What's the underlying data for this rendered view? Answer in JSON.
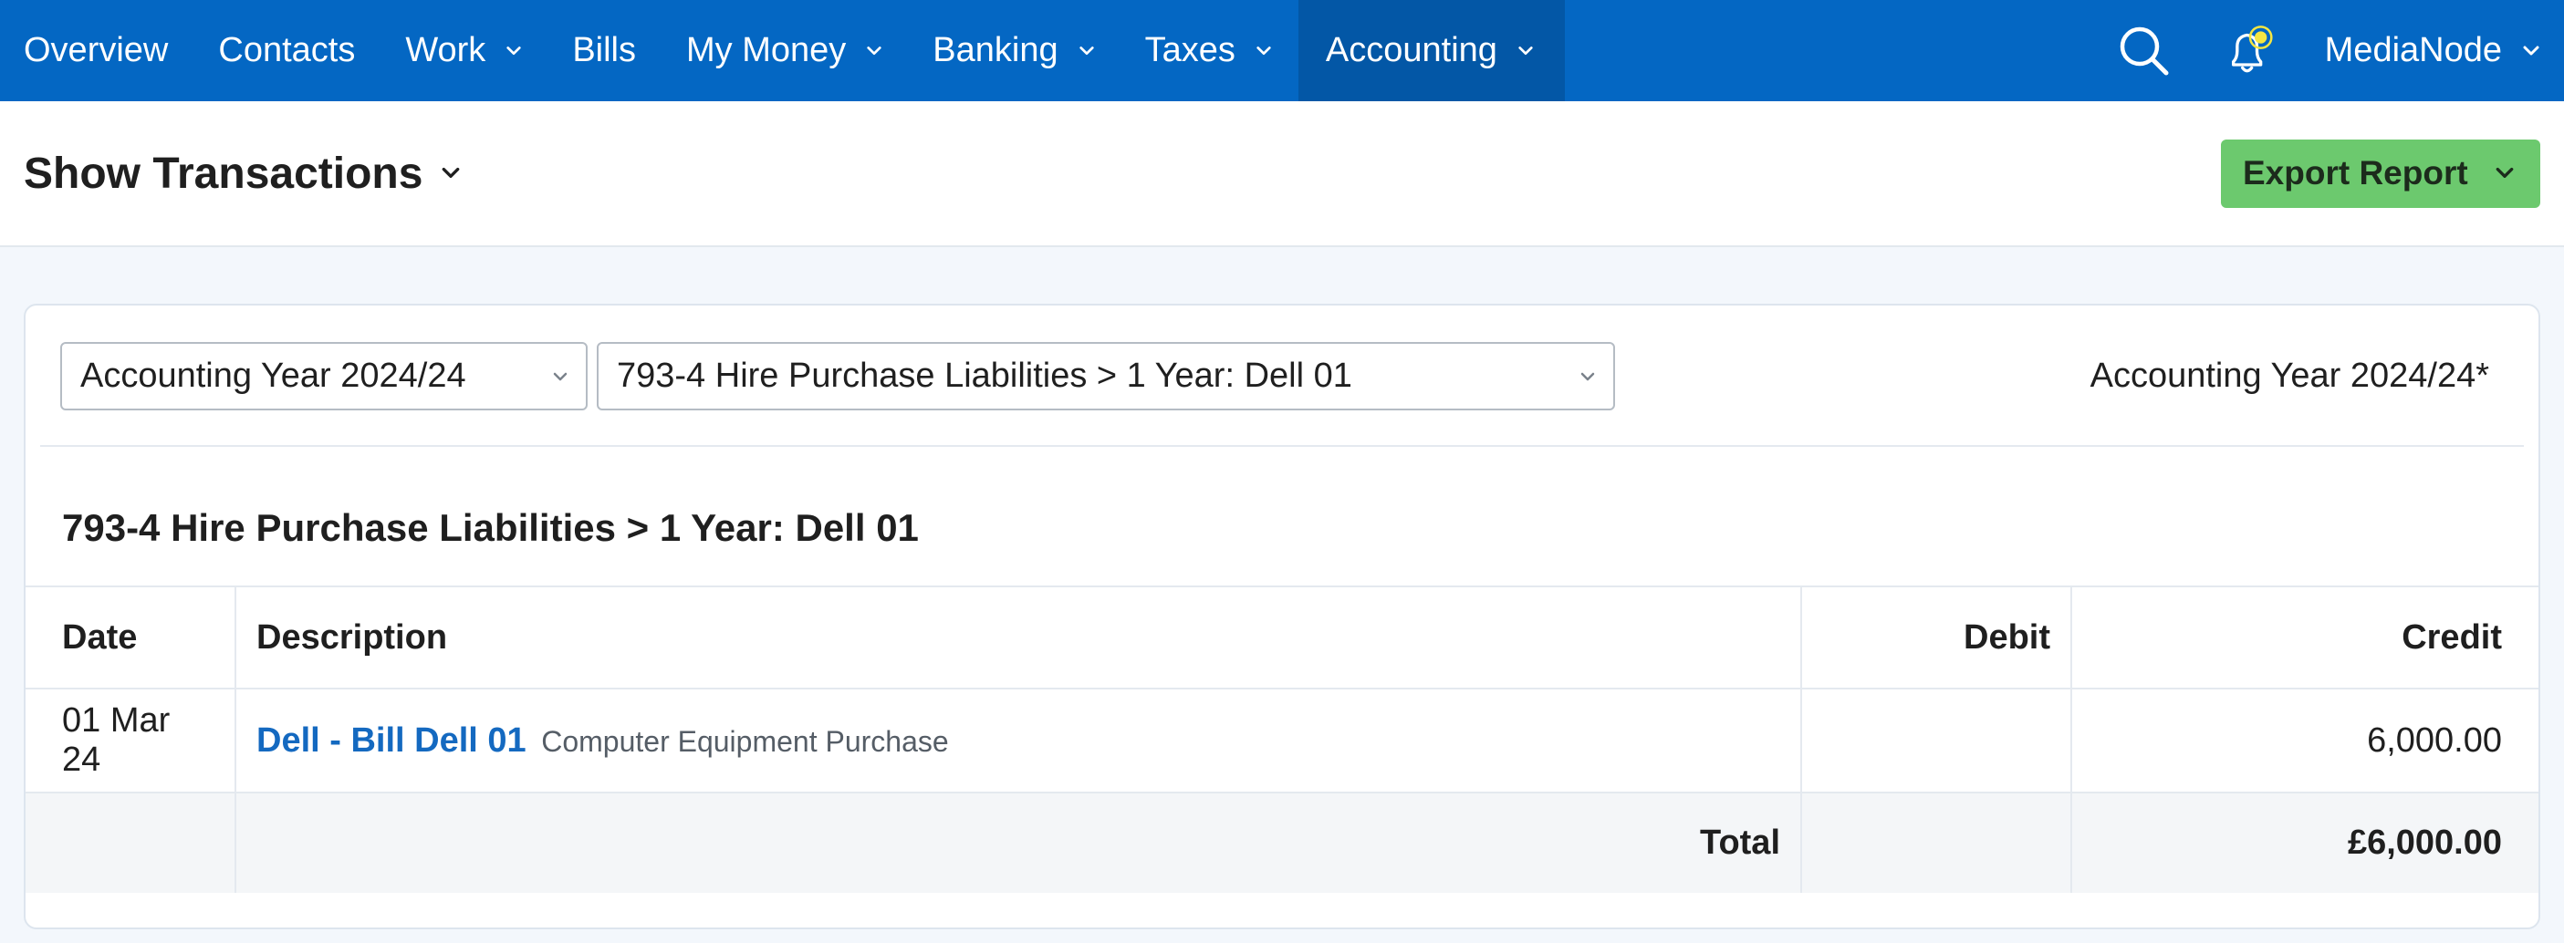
{
  "nav": {
    "items": [
      {
        "label": "Overview",
        "dropdown": false
      },
      {
        "label": "Contacts",
        "dropdown": false
      },
      {
        "label": "Work",
        "dropdown": true
      },
      {
        "label": "Bills",
        "dropdown": false
      },
      {
        "label": "My Money",
        "dropdown": true
      },
      {
        "label": "Banking",
        "dropdown": true
      },
      {
        "label": "Taxes",
        "dropdown": true
      },
      {
        "label": "Accounting",
        "dropdown": true,
        "active": true
      }
    ],
    "user": "MediaNode",
    "icons": {
      "search": "search-icon",
      "notifications": "bell-icon"
    },
    "colors": {
      "bar": "#0467c3",
      "active": "#0357a6",
      "bell_dot": "#f5e642"
    }
  },
  "header": {
    "title": "Show Transactions",
    "export_label": "Export Report"
  },
  "filters": {
    "year_select": "Accounting Year 2024/24",
    "account_select": "793-4 Hire Purchase Liabilities > 1 Year: Dell 01",
    "year_label": "Accounting Year 2024/24*"
  },
  "ledger": {
    "title": "793-4 Hire Purchase Liabilities > 1 Year: Dell 01",
    "columns": {
      "date": "Date",
      "description": "Description",
      "debit": "Debit",
      "credit": "Credit"
    },
    "rows": [
      {
        "date": "01 Mar 24",
        "link": "Dell - Bill Dell 01",
        "note": "Computer Equipment Purchase",
        "debit": "",
        "credit": "6,000.00"
      }
    ],
    "total": {
      "label": "Total",
      "debit": "",
      "credit": "£6,000.00"
    }
  }
}
